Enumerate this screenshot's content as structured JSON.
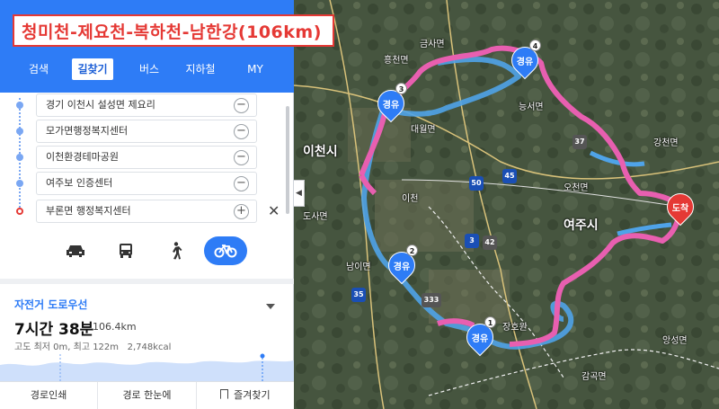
{
  "title": "청미천-제요천-복하천-남한강(106km)",
  "tabs": [
    {
      "label": "검색",
      "active": false
    },
    {
      "label": "길찾기",
      "active": true
    },
    {
      "label": "버스",
      "active": false
    },
    {
      "label": "지하철",
      "active": false
    },
    {
      "label": "MY",
      "active": false
    }
  ],
  "waypoints": [
    {
      "name": "경기 이천시 설성면 제요리",
      "button": "−"
    },
    {
      "name": "모가면행정복지센터",
      "button": "−"
    },
    {
      "name": "이천환경테마공원",
      "button": "−"
    },
    {
      "name": "여주보 인증센터",
      "button": "−"
    },
    {
      "name": "부론면 행정복지센터",
      "button": "+"
    }
  ],
  "close_symbol": "✕",
  "modes": [
    {
      "icon": "car-icon",
      "active": false
    },
    {
      "icon": "bus-icon",
      "active": false
    },
    {
      "icon": "walk-icon",
      "active": false
    },
    {
      "icon": "bicycle-icon",
      "active": true
    }
  ],
  "route": {
    "type": "자전거 도로우선",
    "time": "7시간 38분",
    "distance": "106.4km",
    "meta": "고도 최저 0m, 최고 122m",
    "calories": "2,748kcal"
  },
  "footer": {
    "print": "경로인쇄",
    "overview": "경로 한눈에",
    "favorite": "즐겨찾기"
  },
  "map": {
    "labels": {
      "city": "이천시",
      "s1": "이천",
      "s2": "남이면",
      "s3": "도사면",
      "s4": "장호원",
      "s5": "오천면",
      "s6": "능서면",
      "s7": "강천면",
      "s8": "감곡면",
      "s9": "앙성면",
      "s10": "대월면",
      "s11": "금사면",
      "s12": "흥천면",
      "s13": "여주시"
    },
    "roads": [
      "50",
      "45",
      "3",
      "35",
      "333",
      "42",
      "37"
    ],
    "pins": [
      {
        "text": "경유",
        "num": "1"
      },
      {
        "text": "경유",
        "num": "2"
      },
      {
        "text": "경유",
        "num": "3"
      },
      {
        "text": "경유",
        "num": "4"
      },
      {
        "text": "도착",
        "num": ""
      }
    ],
    "colors": {
      "route_main": "#e85fb0",
      "route_alt": "#4fa3e8",
      "pin": "#2e7cf6",
      "end": "#e53935"
    }
  }
}
